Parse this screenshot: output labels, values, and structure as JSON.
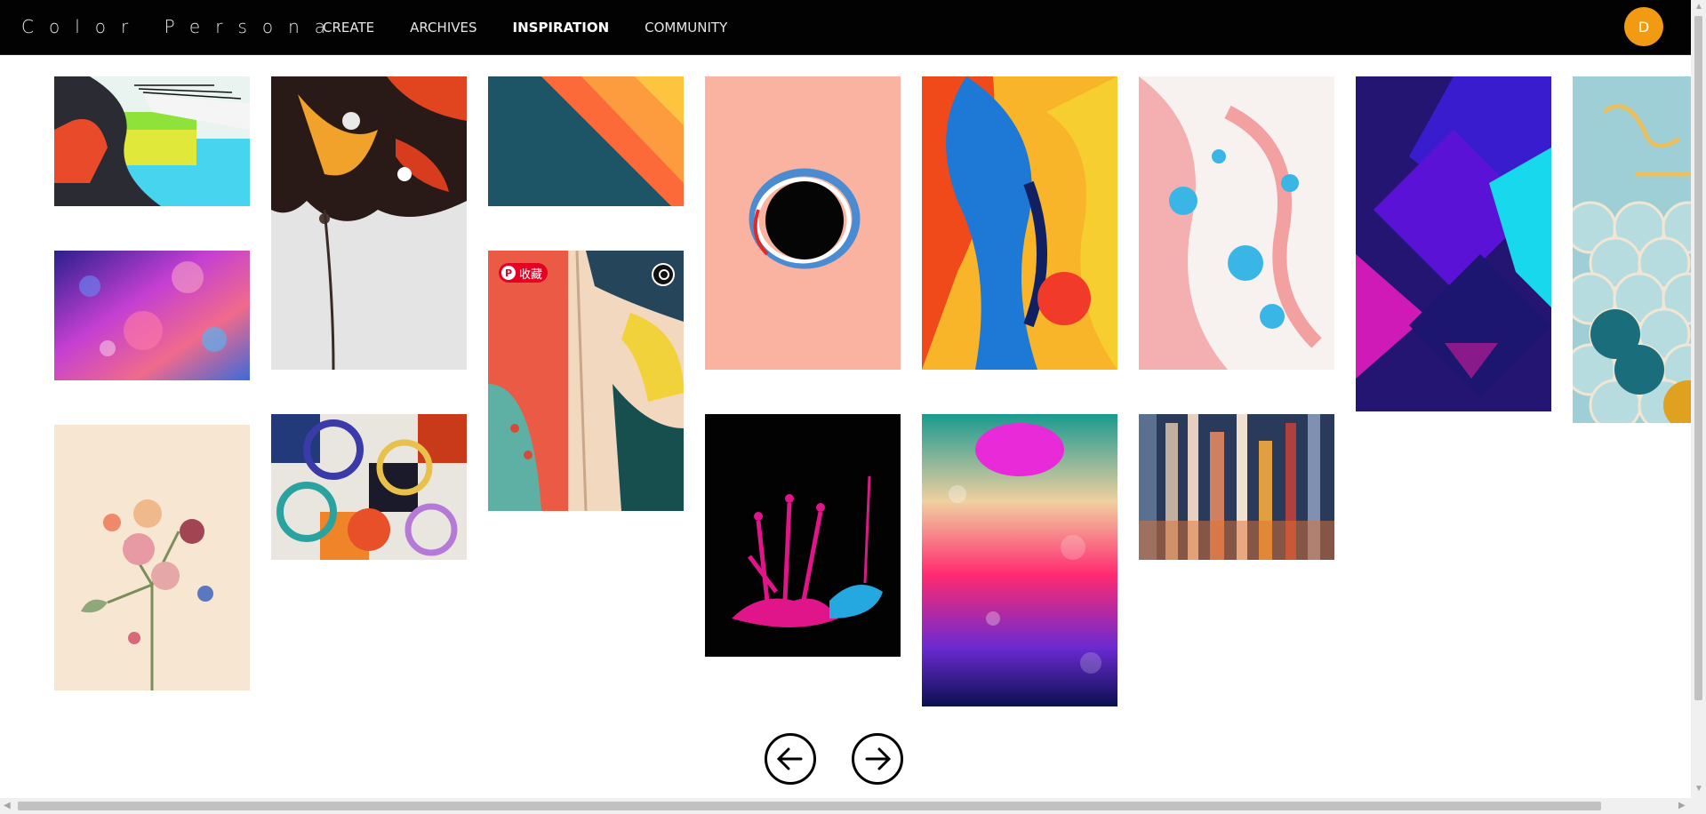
{
  "brand": {
    "logo_text": "Color Persona"
  },
  "nav": {
    "items": [
      {
        "label": "CREATE"
      },
      {
        "label": "ARCHIVES"
      },
      {
        "label": "INSPIRATION"
      },
      {
        "label": "COMMUNITY"
      }
    ]
  },
  "user": {
    "avatar_initial": "D",
    "avatar_color": "#f29a12"
  },
  "pin_overlay": {
    "save_label": "收藏",
    "pin_icon_letter": "P",
    "brand_color": "#e60023"
  },
  "gallery": {
    "items": [
      {
        "name": "woman-profile-neon"
      },
      {
        "name": "fluid-art-flower"
      },
      {
        "name": "geometric-diagonal-stripes"
      },
      {
        "name": "black-hole-peach"
      },
      {
        "name": "fluid-blue-orange"
      },
      {
        "name": "pink-blue-marble"
      },
      {
        "name": "purple-geometric"
      },
      {
        "name": "ice-cream-therapy-scales"
      },
      {
        "name": "iridescent-bubbles"
      },
      {
        "name": "abstract-boho-painting"
      },
      {
        "name": "vintage-floral-bouquet"
      },
      {
        "name": "circles-mosaic"
      },
      {
        "name": "pink-paint-splash"
      },
      {
        "name": "neon-liquid-bubbles"
      },
      {
        "name": "glass-columns-reflection"
      }
    ]
  },
  "pagination": {
    "prev_icon": "arrow-left-icon",
    "next_icon": "arrow-right-icon"
  }
}
